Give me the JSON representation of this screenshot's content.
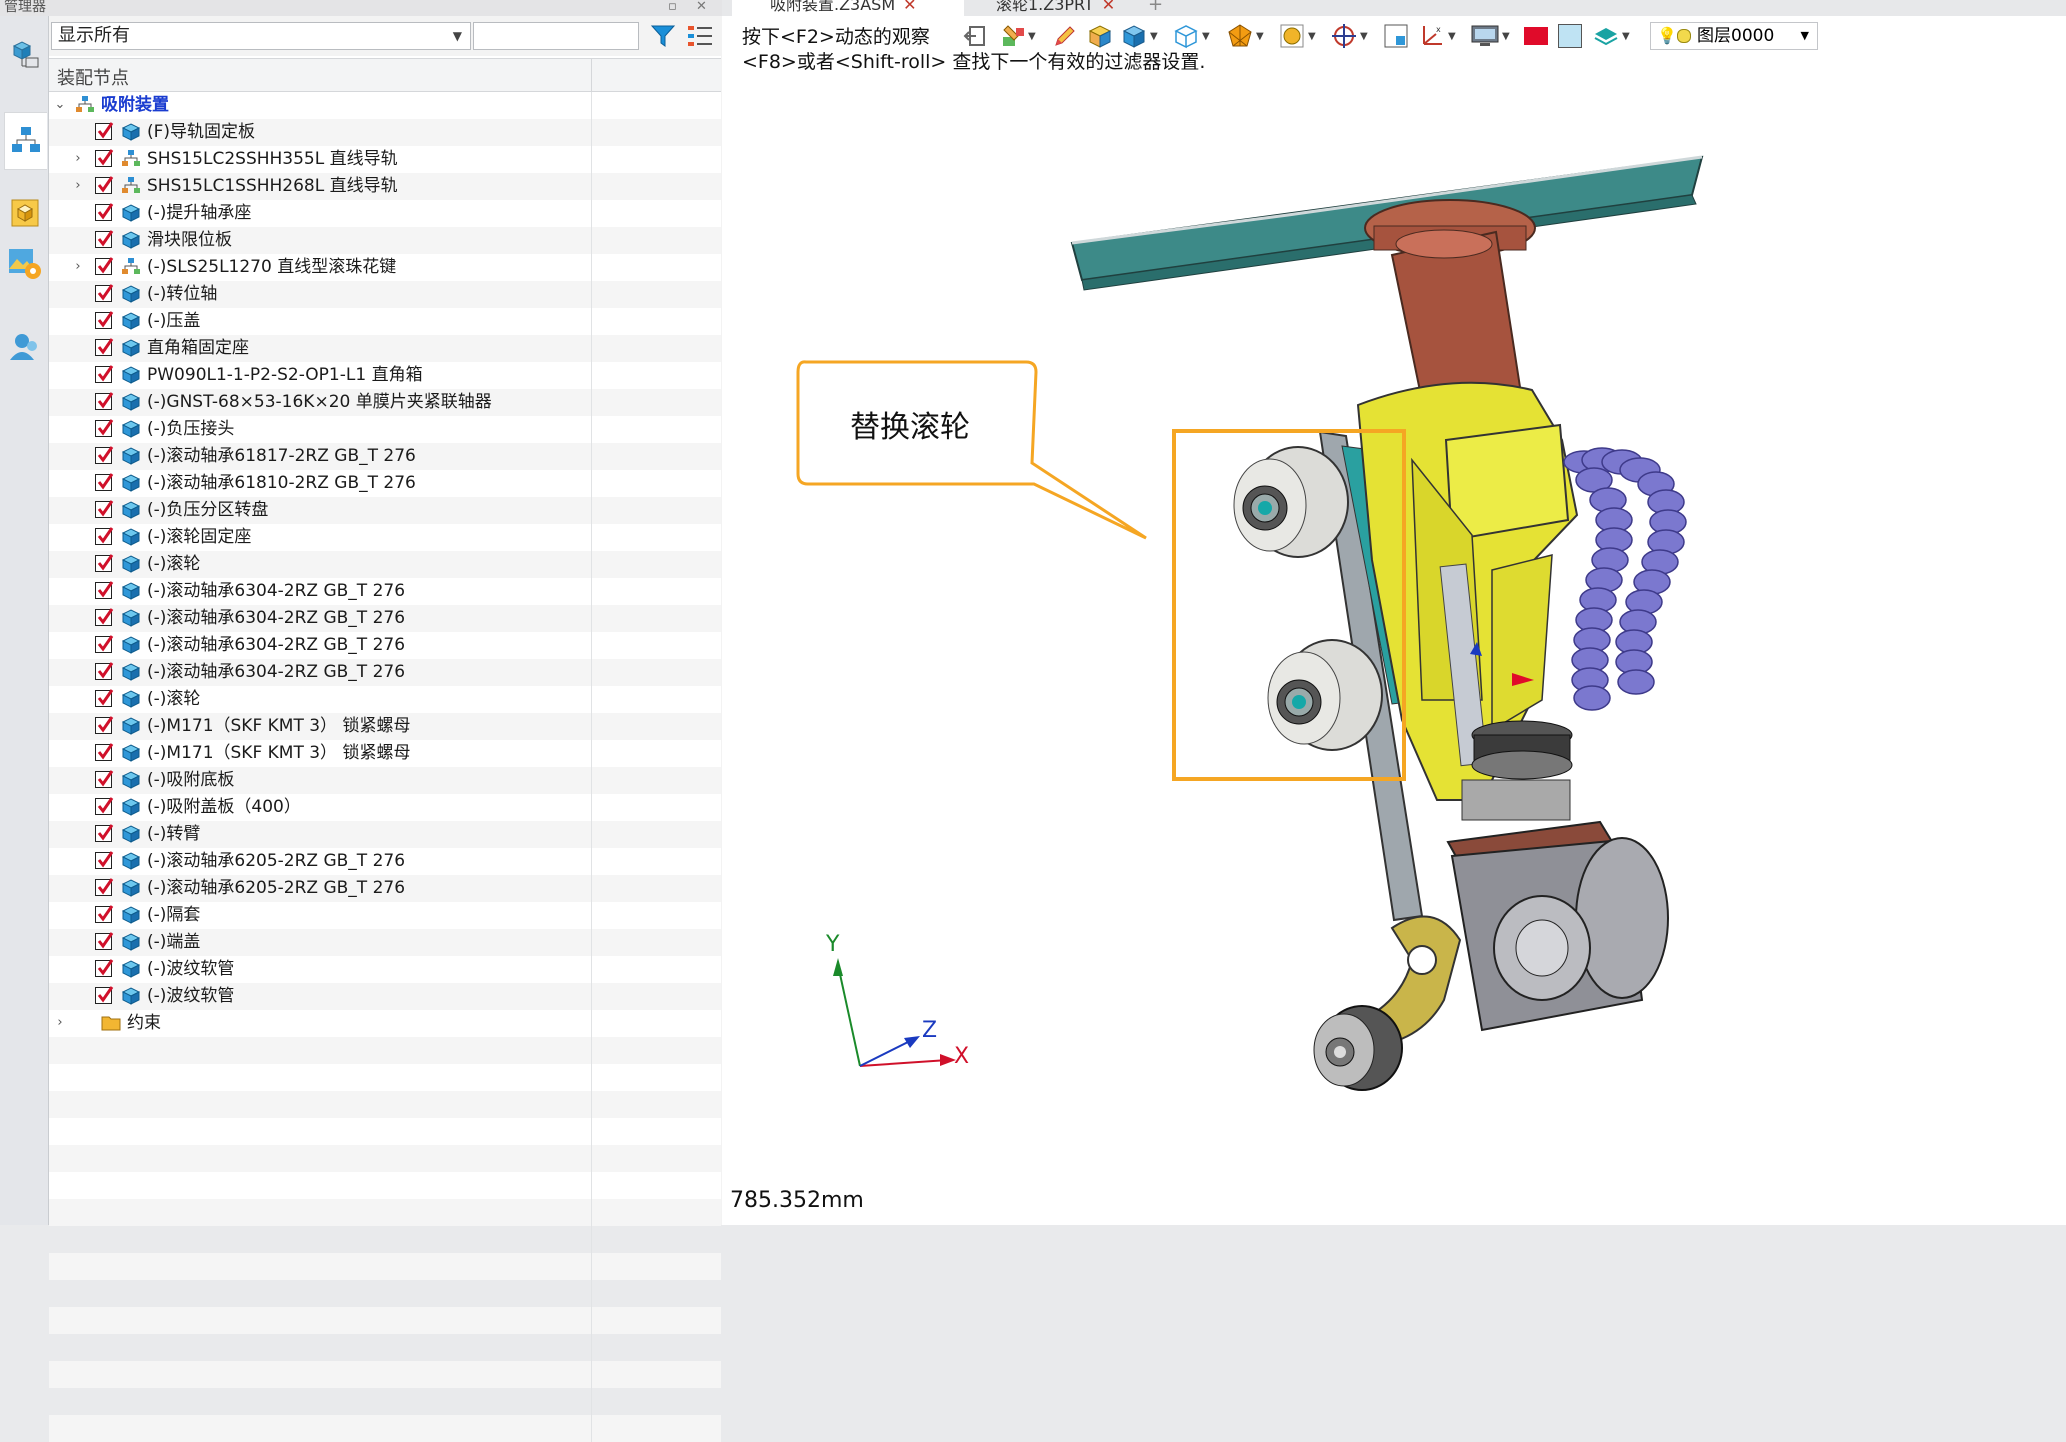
{
  "left_panel": {
    "title": "管理器",
    "filter": {
      "selected": "显示所有",
      "input_value": ""
    },
    "tree_header": "装配节点",
    "side_icons": [
      "part-icon",
      "assembly-tree-icon",
      "cube-icon",
      "view-icon",
      "user-icon"
    ],
    "rows": [
      {
        "label": "吸附装置",
        "type": "assembly",
        "level": 0,
        "expander": "open",
        "checked": false,
        "root": true
      },
      {
        "label": "(F)导轨固定板",
        "type": "part",
        "level": 1,
        "expander": "",
        "checked": true
      },
      {
        "label": "SHS15LC2SSHH355L 直线导轨",
        "type": "assembly",
        "level": 1,
        "expander": "closed",
        "checked": true
      },
      {
        "label": "SHS15LC1SSHH268L 直线导轨",
        "type": "assembly",
        "level": 1,
        "expander": "closed",
        "checked": true
      },
      {
        "label": "(-)提升轴承座",
        "type": "part",
        "level": 1,
        "expander": "",
        "checked": true
      },
      {
        "label": "滑块限位板",
        "type": "part",
        "level": 1,
        "expander": "",
        "checked": true
      },
      {
        "label": "(-)SLS25L1270 直线型滚珠花键",
        "type": "assembly",
        "level": 1,
        "expander": "closed",
        "checked": true
      },
      {
        "label": "(-)转位轴",
        "type": "part",
        "level": 1,
        "expander": "",
        "checked": true
      },
      {
        "label": "(-)压盖",
        "type": "part",
        "level": 1,
        "expander": "",
        "checked": true
      },
      {
        "label": "直角箱固定座",
        "type": "part",
        "level": 1,
        "expander": "",
        "checked": true
      },
      {
        "label": "PW090L1-1-P2-S2-OP1-L1 直角箱",
        "type": "part",
        "level": 1,
        "expander": "",
        "checked": true
      },
      {
        "label": "(-)GNST-68×53-16K×20 单膜片夹紧联轴器",
        "type": "part",
        "level": 1,
        "expander": "",
        "checked": true
      },
      {
        "label": "(-)负压接头",
        "type": "part",
        "level": 1,
        "expander": "",
        "checked": true
      },
      {
        "label": "(-)滚动轴承61817-2RZ GB_T 276",
        "type": "part",
        "level": 1,
        "expander": "",
        "checked": true
      },
      {
        "label": "(-)滚动轴承61810-2RZ GB_T 276",
        "type": "part",
        "level": 1,
        "expander": "",
        "checked": true
      },
      {
        "label": "(-)负压分区转盘",
        "type": "part",
        "level": 1,
        "expander": "",
        "checked": true
      },
      {
        "label": "(-)滚轮固定座",
        "type": "part",
        "level": 1,
        "expander": "",
        "checked": true
      },
      {
        "label": "(-)滚轮",
        "type": "part",
        "level": 1,
        "expander": "",
        "checked": true
      },
      {
        "label": "(-)滚动轴承6304-2RZ GB_T 276",
        "type": "part",
        "level": 1,
        "expander": "",
        "checked": true
      },
      {
        "label": "(-)滚动轴承6304-2RZ GB_T 276",
        "type": "part",
        "level": 1,
        "expander": "",
        "checked": true
      },
      {
        "label": "(-)滚动轴承6304-2RZ GB_T 276",
        "type": "part",
        "level": 1,
        "expander": "",
        "checked": true
      },
      {
        "label": "(-)滚动轴承6304-2RZ GB_T 276",
        "type": "part",
        "level": 1,
        "expander": "",
        "checked": true
      },
      {
        "label": "(-)滚轮",
        "type": "part",
        "level": 1,
        "expander": "",
        "checked": true
      },
      {
        "label": "(-)M171（SKF KMT 3） 锁紧螺母",
        "type": "part",
        "level": 1,
        "expander": "",
        "checked": true
      },
      {
        "label": "(-)M171（SKF KMT 3） 锁紧螺母",
        "type": "part",
        "level": 1,
        "expander": "",
        "checked": true
      },
      {
        "label": "(-)吸附底板",
        "type": "part",
        "level": 1,
        "expander": "",
        "checked": true
      },
      {
        "label": "(-)吸附盖板（400）",
        "type": "part",
        "level": 1,
        "expander": "",
        "checked": true
      },
      {
        "label": "(-)转臂",
        "type": "part",
        "level": 1,
        "expander": "",
        "checked": true
      },
      {
        "label": "(-)滚动轴承6205-2RZ GB_T 276",
        "type": "part",
        "level": 1,
        "expander": "",
        "checked": true
      },
      {
        "label": "(-)滚动轴承6205-2RZ GB_T 276",
        "type": "part",
        "level": 1,
        "expander": "",
        "checked": true
      },
      {
        "label": "(-)隔套",
        "type": "part",
        "level": 1,
        "expander": "",
        "checked": true
      },
      {
        "label": "(-)端盖",
        "type": "part",
        "level": 1,
        "expander": "",
        "checked": true
      },
      {
        "label": "(-)波纹软管",
        "type": "part",
        "level": 1,
        "expander": "",
        "checked": true
      },
      {
        "label": "(-)波纹软管",
        "type": "part",
        "level": 1,
        "expander": "",
        "checked": true
      },
      {
        "label": "约束",
        "type": "folder",
        "level": 0,
        "expander": "closed",
        "checked": false
      }
    ],
    "empty_rows": 7
  },
  "tabs": [
    {
      "label": "吸附装置.Z3ASM",
      "close": "✕",
      "active": true
    },
    {
      "label": "滚轮1.Z3PRT",
      "close": "✕",
      "active": false
    },
    {
      "label": "+",
      "close": "",
      "active": false
    }
  ],
  "hints": {
    "line1": "按下<F2>动态的观察",
    "line2": "<F8>或者<Shift-roll> 查找下一个有效的过滤器设置."
  },
  "toolbar": {
    "icons": [
      "exit-icon",
      "paint-icon",
      "pencil-icon",
      "shaded-cube-icon",
      "solid-cube-icon",
      "wireframe-cube-icon",
      "orient-icon",
      "render-icon",
      "target-icon",
      "zoom-icon",
      "axis-icon",
      "display-icon",
      "color-icon",
      "box-icon",
      "layer-style-icon"
    ],
    "swatch_red": "#e00b2a",
    "swatch_blue": "#bfe3f3",
    "layer": "图层0000"
  },
  "viewport": {
    "callout": "替换滚轮",
    "scale": "785.352mm",
    "axes": {
      "x": "X",
      "y": "Y",
      "z": "Z"
    },
    "colors": {
      "plate": "#3d8a88",
      "column": "#a6533e",
      "housing": "#e5e234",
      "hose": "#7b78cf",
      "roller": "#dcdcd8",
      "gearbox": "#8f9097",
      "highlight": "#f5a623",
      "arm": "#c9b54a"
    }
  }
}
